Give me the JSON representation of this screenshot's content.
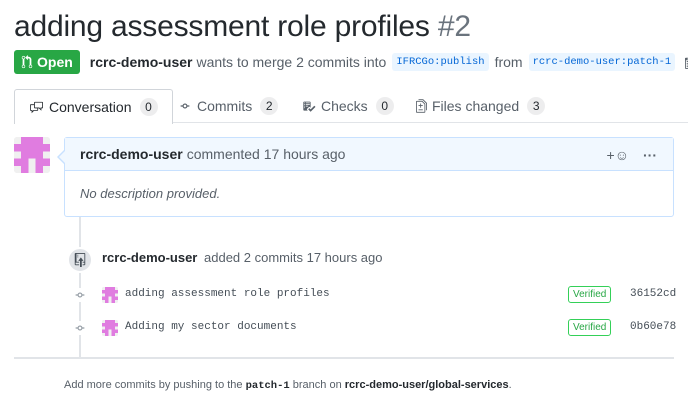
{
  "pr": {
    "title": "adding assessment role profiles",
    "number": "#2",
    "state": "Open",
    "author": "rcrc-demo-user",
    "merge_text": "wants to merge 2 commits into",
    "base_branch": "IFRCGo:publish",
    "from_text": "from",
    "head_branch": "rcrc-demo-user:patch-1"
  },
  "tabs": [
    {
      "label": "Conversation",
      "count": "0",
      "icon": "comment-discussion-icon"
    },
    {
      "label": "Commits",
      "count": "2",
      "icon": "git-commit-icon"
    },
    {
      "label": "Checks",
      "count": "0",
      "icon": "checklist-icon"
    },
    {
      "label": "Files changed",
      "count": "3",
      "icon": "file-diff-icon"
    }
  ],
  "comment": {
    "author": "rcrc-demo-user",
    "action": "commented 17 hours ago",
    "body": "No description provided.",
    "reaction_label": "+☺",
    "more_label": "···"
  },
  "event": {
    "author": "rcrc-demo-user",
    "text": "added 2 commits 17 hours ago"
  },
  "commits": [
    {
      "message": "adding assessment role profiles",
      "verified": "Verified",
      "sha": "36152cd"
    },
    {
      "message": "Adding my sector documents",
      "verified": "Verified",
      "sha": "0b60e78"
    }
  ],
  "footer": {
    "prefix": "Add more commits by pushing to the",
    "branch": "patch-1",
    "middle": "branch on",
    "repo": "rcrc-demo-user/global-services",
    "suffix": "."
  },
  "colors": {
    "open_green": "#28a745",
    "link_blue": "#0366d6",
    "comment_border": "#c8e1ff",
    "avatar_pink": "#e07ce0"
  }
}
